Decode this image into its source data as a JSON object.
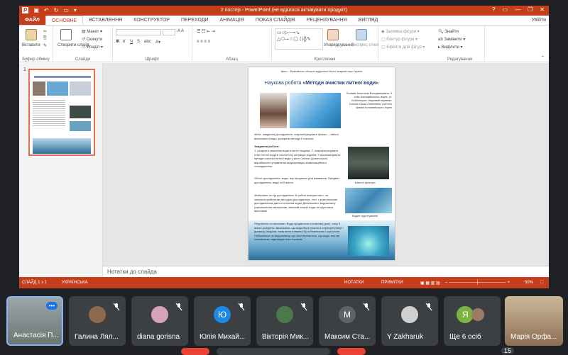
{
  "window": {
    "title": "2 постер - PowerPoint (не вдалося активувати продукт)",
    "help": "?",
    "min": "—",
    "max": "❐",
    "close": "✕"
  },
  "tabs": [
    "ФАЙЛ",
    "ОСНОВНЕ",
    "ВСТАВЛЕННЯ",
    "КОНСТРУКТОР",
    "ПЕРЕХОДИ",
    "АНІМАЦІЯ",
    "ПОКАЗ СЛАЙДІВ",
    "РЕЦЕНЗУВАННЯ",
    "ВИГЛЯД"
  ],
  "user": "Увійти",
  "ribbon": {
    "paste": "Вставити",
    "clipboard": "Буфер обміну",
    "new_slide": "Створити слайд",
    "layout": "Макет",
    "reset": "Скинути",
    "section": "Розділ",
    "slides": "Слайди",
    "font": "Шрифт",
    "paragraph": "Абзац",
    "arrange": "Упорядкування",
    "quick_styles": "Експрес-стилі",
    "drawing": "Креслення",
    "shape_fill": "Заливка фігури",
    "shape_outline": "Контур фігури",
    "shape_effects": "Ефекти для фігур",
    "find": "Знайти",
    "replace": "Замінити",
    "select": "Виділити",
    "editing": "Редагування"
  },
  "thumbnail_number": "1",
  "notes_placeholder": "Нотатки до слайда",
  "status": {
    "slide": "СЛАЙД 1 з 1",
    "language": "УКРАЇНСЬКА",
    "notes": "НОТАТКИ",
    "comments": "ПРИМІТКИ",
    "zoom": "50%"
  },
  "slide": {
    "header": "Івано – Франківське обласне відділення Малої академії наук України",
    "title_plain": "Наукова робота ",
    "title_bold": "«Методи очистки питної води»",
    "author": "Поляків Анастасія Володимирівна, 9 клас Коломийського ліцею, ст. Кобилецька. Науковий керівник: Стасюк Ольга Семенівна, учитель фізики Коломийського ліцею",
    "goal": "Мета, завдання дослідження: охарактеризувати фізико – хімічні властивості води, розкрити методи її очистки.",
    "tasks_title": "Завдання роботи:",
    "tasks": "1. розкрити значення води в житті людини; 2. охарактеризувати стан питної води в екологічну ситуацію водойм; 3.проаналізувати методи очистки питної води у місті Снятин Долинського виробничого управління водопровідно-каналізаційного господарства.",
    "object": "Об'єкт дослідження: вода, яку продаємо для вживання. Предмет дослідження: вода та її якість.",
    "filter_caption": "Шахтні фільтри",
    "materials": "Матеріали та хід дослідження: В роботі використано, за загальноприйнятим методом дослідження, тест з комплексним дослідженням даного питання щодо Долинського водоканалу, узагальнення матеріалів, хімічний аналіз води та підготовка висновків.",
    "water_caption": "Водне підготування",
    "results": "Результати та висновки: Воду продається в кожному домі, тому її якість розкрито. Визначено, що вода бере участь в терморегуляції і динаміці людини, тому вона повинна бути безпечною і корисною. Побіжимося по водоканалу, що спостерігається, що вода, яку ми споживаємо відповідає всім нормам."
  },
  "participants": [
    {
      "name": "Анастасія П...",
      "badge": "•••"
    },
    {
      "name": "Галина Лял...",
      "initial": ""
    },
    {
      "name": "diana gorisna",
      "initial": ""
    },
    {
      "name": "Юлія Михай...",
      "initial": "Ю"
    },
    {
      "name": "Вікторія Мик...",
      "initial": ""
    },
    {
      "name": "Максим Ста...",
      "initial": "М"
    },
    {
      "name": "Y Zakharuk",
      "initial": ""
    },
    {
      "name": "Ще 6 осіб",
      "initial": "Я"
    },
    {
      "name": "Марія Орфа...",
      "initial": ""
    }
  ],
  "self_count": "15",
  "colors": {
    "accent": "#c43e1c",
    "meet_bg": "#202124",
    "tile": "#3c4043",
    "active_tile": "#8ab4f8"
  }
}
